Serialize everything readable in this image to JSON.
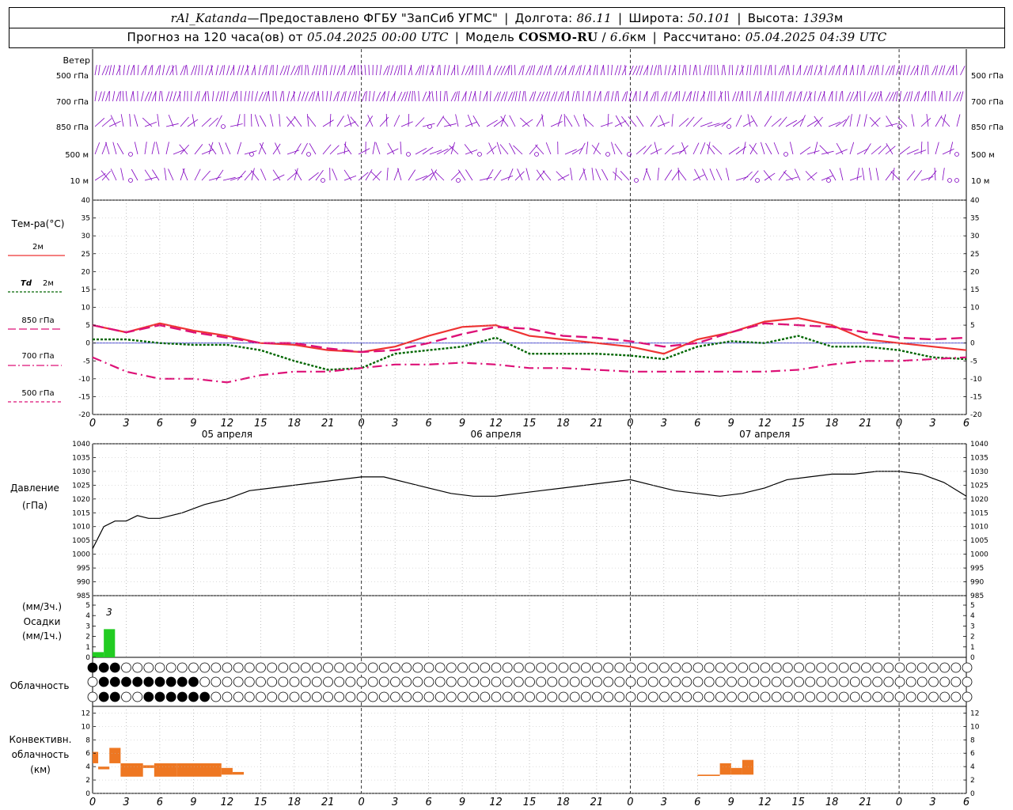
{
  "header": {
    "station": "rAl_Katanda",
    "dash": " — ",
    "provider": "Предоставлено ФГБУ \"ЗапСиб УГМС\"",
    "lon_label": "Долгота:",
    "lon_value": "86.11",
    "lat_label": "Широта:",
    "lat_value": "50.101",
    "alt_label": "Высота:",
    "alt_value": "1393",
    "alt_unit": "м",
    "forecast_label": "Прогноз на 120 часа(ов) от",
    "forecast_time": "05.04.2025 00:00 UTC",
    "model_label": "Модель",
    "model_name": "COSMO-RU",
    "model_res": "6.6",
    "model_res_unit": "км",
    "calc_label": "Рассчитано:",
    "calc_time": "05.04.2025 04:39 UTC"
  },
  "colors": {
    "wind": "#8000c0",
    "t2m": "#ee3333",
    "td2m": "#006600",
    "t850": "#dd1177",
    "t700": "#dd1177",
    "t500": "#dd1177",
    "pressure": "#000000",
    "precip": "#22cc22",
    "conv": "#ee7722"
  },
  "wind": {
    "title": "Ветер",
    "levels": [
      "500 гПа",
      "700 гПа",
      "850 гПа",
      "500 м",
      "10 м"
    ]
  },
  "time_axis": {
    "hour_labels": [
      "0",
      "3",
      "6",
      "9",
      "12",
      "15",
      "18",
      "21",
      "0",
      "3",
      "6",
      "9",
      "12",
      "15",
      "18",
      "21",
      "0",
      "3",
      "6",
      "9",
      "12",
      "15",
      "18",
      "21",
      "0",
      "3",
      "6"
    ],
    "dates": [
      "05 апреля",
      "06 апреля",
      "07 апреля"
    ]
  },
  "temperature_legend": {
    "title": "Тем-ра(°C)",
    "t2m": "2м",
    "td_a": "Td",
    "td_b": "2м",
    "t850": "850 гПа",
    "t700": "700 гПа",
    "t500": "500 гПа"
  },
  "pressure_legend": {
    "title": "Давление",
    "unit": "(гПа)"
  },
  "precip_legend": {
    "unit3": "(мм/3ч.)",
    "title": "Осадки",
    "unit1": "(мм/1ч.)",
    "annotation": "3"
  },
  "cloud_legend": {
    "title": "Облачность"
  },
  "conv_legend": {
    "line1": "Конвективн.",
    "line2": "облачность",
    "line3": "(км)"
  },
  "chart_data": [
    {
      "type": "line",
      "name": "temperature",
      "ylim": [
        -20,
        40
      ],
      "yticks": [
        -20,
        -15,
        -10,
        -5,
        0,
        5,
        10,
        15,
        20,
        25,
        30,
        35,
        40
      ],
      "x": [
        0,
        3,
        6,
        9,
        12,
        15,
        18,
        21,
        24,
        27,
        30,
        33,
        36,
        39,
        42,
        45,
        48,
        51,
        54,
        57,
        60,
        63,
        66,
        69,
        72,
        75,
        78
      ],
      "series": [
        {
          "name": "2м",
          "values": [
            5,
            3,
            5.5,
            3.5,
            2,
            0,
            -0.5,
            -2,
            -2.5,
            -1,
            2,
            4.5,
            5,
            2,
            1,
            0,
            -1,
            -3,
            1,
            3,
            6,
            7,
            5,
            1,
            0,
            -1,
            -2
          ]
        },
        {
          "name": "Td 2м",
          "values": [
            1,
            1,
            0,
            -0.5,
            -0.5,
            -2,
            -5,
            -7.5,
            -7,
            -3,
            -2,
            -1,
            1.5,
            -3,
            -3,
            -3,
            -3.5,
            -4.5,
            -1,
            0.5,
            0,
            2,
            -1,
            -1,
            -2,
            -4,
            -4.5
          ]
        },
        {
          "name": "850 гПа",
          "values": [
            5,
            3,
            5,
            3,
            1.5,
            0,
            0,
            -1.5,
            -2.5,
            -2,
            0,
            2.5,
            4.5,
            4,
            2,
            1.5,
            0.5,
            -1,
            0,
            3,
            5.5,
            5,
            4.5,
            3,
            1.5,
            1,
            1.5
          ]
        },
        {
          "name": "700 гПа",
          "values": [
            -4,
            -8,
            -10,
            -10,
            -11,
            -9,
            -8,
            -8,
            -7,
            -6,
            -6,
            -5.5,
            -6,
            -7,
            -7,
            -7.5,
            -8,
            -8,
            -8,
            -8,
            -8,
            -7.5,
            -6,
            -5,
            -5,
            -4.5,
            -4
          ]
        }
      ]
    },
    {
      "type": "line",
      "name": "pressure",
      "ylim": [
        985,
        1040
      ],
      "yticks": [
        985,
        990,
        995,
        1000,
        1005,
        1010,
        1015,
        1020,
        1025,
        1030,
        1035,
        1040
      ],
      "x": [
        0,
        1,
        2,
        3,
        4,
        5,
        6,
        8,
        10,
        12,
        14,
        16,
        18,
        20,
        22,
        24,
        26,
        28,
        30,
        32,
        34,
        36,
        38,
        40,
        42,
        44,
        46,
        48,
        50,
        52,
        54,
        56,
        58,
        60,
        62,
        64,
        66,
        68,
        70,
        72,
        74,
        76,
        78
      ],
      "values": [
        1002,
        1010,
        1012,
        1012,
        1014,
        1013,
        1013,
        1015,
        1018,
        1020,
        1023,
        1024,
        1025,
        1026,
        1027,
        1028,
        1028,
        1026,
        1024,
        1022,
        1021,
        1021,
        1022,
        1023,
        1024,
        1025,
        1026,
        1027,
        1025,
        1023,
        1022,
        1021,
        1022,
        1024,
        1027,
        1028,
        1029,
        1029,
        1030,
        1030,
        1029,
        1026,
        1021
      ]
    },
    {
      "type": "bar",
      "name": "precipitation",
      "ylim": [
        0,
        5
      ],
      "yticks": [
        0,
        1,
        2,
        3,
        4,
        5
      ],
      "bars": [
        {
          "x": [
            0,
            1
          ],
          "value": 0.5
        },
        {
          "x": [
            1,
            2
          ],
          "value": 2.7
        }
      ]
    },
    {
      "type": "bar",
      "name": "convective_cloud",
      "ylim": [
        0,
        13
      ],
      "yticks": [
        0,
        2,
        4,
        6,
        8,
        10,
        12
      ],
      "bars": [
        {
          "x": [
            0,
            0.5
          ],
          "bottom": 4.5,
          "top": 6.2
        },
        {
          "x": [
            0.5,
            1.5
          ],
          "bottom": 3.6,
          "top": 4
        },
        {
          "x": [
            1.5,
            2.5
          ],
          "bottom": 4.5,
          "top": 6.8
        },
        {
          "x": [
            2.5,
            4.5
          ],
          "bottom": 2.5,
          "top": 4.5
        },
        {
          "x": [
            4.5,
            5.5
          ],
          "bottom": 3.8,
          "top": 4.2
        },
        {
          "x": [
            5.5,
            7.5
          ],
          "bottom": 2.5,
          "top": 4.5
        },
        {
          "x": [
            7.5,
            11.5
          ],
          "bottom": 2.5,
          "top": 4.5
        },
        {
          "x": [
            11.5,
            12.5
          ],
          "bottom": 2.8,
          "top": 3.8
        },
        {
          "x": [
            12.5,
            13.5
          ],
          "bottom": 2.8,
          "top": 3.2
        },
        {
          "x": [
            54,
            56
          ],
          "bottom": 2.6,
          "top": 2.8
        },
        {
          "x": [
            56,
            57
          ],
          "bottom": 2.8,
          "top": 4.5
        },
        {
          "x": [
            57,
            58
          ],
          "bottom": 2.8,
          "top": 3.8
        },
        {
          "x": [
            58,
            59
          ],
          "bottom": 2.8,
          "top": 5
        }
      ]
    }
  ]
}
